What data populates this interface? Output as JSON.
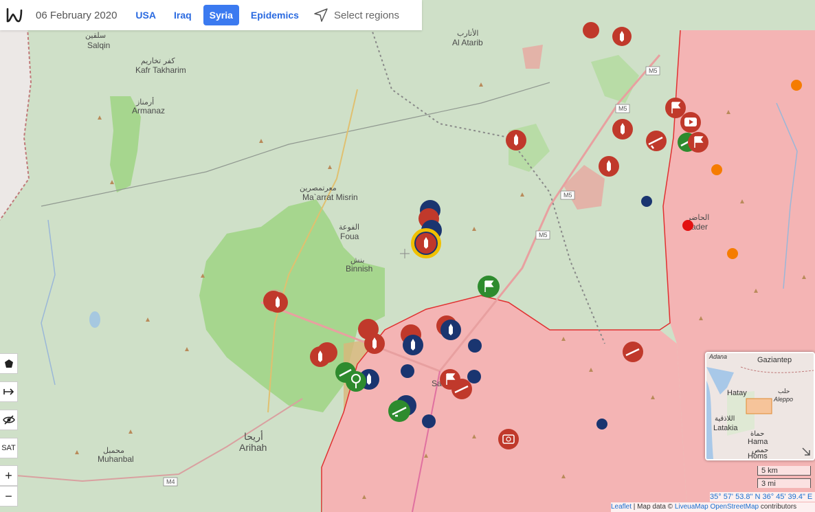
{
  "header": {
    "logo_icon": "liveuamap-logo-icon",
    "date": "06 February 2020",
    "tabs": [
      {
        "label": "USA",
        "active": false
      },
      {
        "label": "Iraq",
        "active": false
      },
      {
        "label": "Syria",
        "active": true
      },
      {
        "label": "Epidemics",
        "active": false
      }
    ],
    "select_regions": "Select regions"
  },
  "map": {
    "places": [
      {
        "ar": "سلقين",
        "en": "Salqin"
      },
      {
        "ar": "كفر تخاريم",
        "en": "Kafr Takharim"
      },
      {
        "ar": "أرمناز",
        "en": "Armanaz"
      },
      {
        "ar": "الأتارب",
        "en": "Al Atarib"
      },
      {
        "ar": "معرتمصرين",
        "en": "Ma`arrat Misrin"
      },
      {
        "ar": "الفوعة",
        "en": "Foua"
      },
      {
        "ar": "بنش",
        "en": "Binnish"
      },
      {
        "ar": "أريحا",
        "en": "Arihah"
      },
      {
        "ar": "محمبل",
        "en": "Muhanbal"
      },
      {
        "ar": "الحاضر",
        "en": "ader"
      },
      {
        "ar": "",
        "en": "Sa"
      }
    ],
    "roads": [
      "M5",
      "M5",
      "M5",
      "M5",
      "M4"
    ],
    "colors": {
      "land": "#cfe0c8",
      "opposition": "#a6d68e",
      "government": "#f4b4b4",
      "turkey_backed": "#d9b77a",
      "front_line": "#e03030"
    }
  },
  "controls": {
    "draw_polygon": "polygon-icon",
    "measure": "measure-icon",
    "hide": "eye-slash-icon",
    "satellite": "SAT",
    "zoom_in": "+",
    "zoom_out": "−"
  },
  "minimap": {
    "labels": [
      "Adana",
      "Gaziantep",
      "Hatay",
      "حلب",
      "Aleppo",
      "اللاذقية",
      "Latakia",
      "حماة",
      "Hama",
      "حمص",
      "Homs"
    ]
  },
  "scale": {
    "km": "5 km",
    "mi": "3 mi"
  },
  "coordinates": "35° 57' 53.8\" N 36° 45' 39.4\" E",
  "attribution": {
    "leaflet": "Leaflet",
    "sep": " | Map data © ",
    "liveuamap": "LiveuaMap",
    "osm": "OpenStreetMap",
    "contributors": " contributors"
  }
}
